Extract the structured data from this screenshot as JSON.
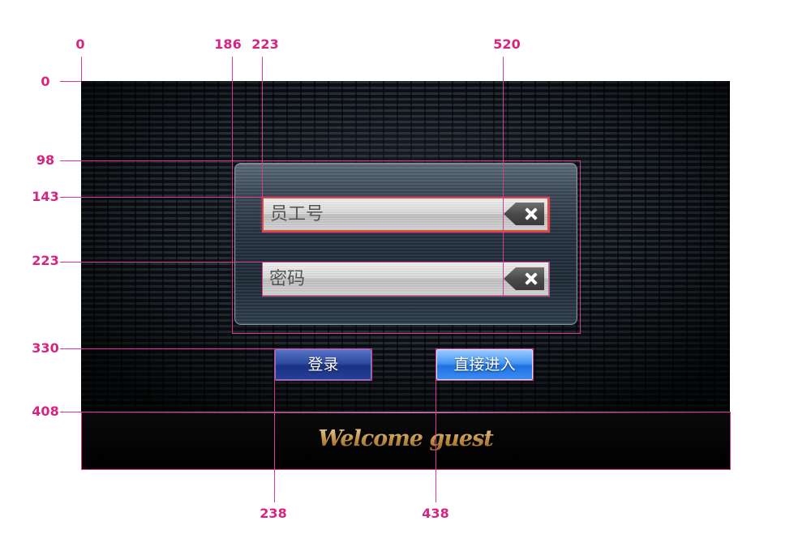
{
  "annotations": {
    "top": [
      "0",
      "186",
      "223",
      "520"
    ],
    "left": [
      "0",
      "98",
      "143",
      "223",
      "330",
      "408"
    ],
    "bottom": [
      "238",
      "438"
    ],
    "color": "#d6257f"
  },
  "login_panel": {
    "employee_field": {
      "placeholder": "员工号",
      "state": "focused",
      "clear_icon": "close-icon"
    },
    "password_field": {
      "placeholder": "密码",
      "clear_icon": "close-icon"
    }
  },
  "buttons": {
    "login_label": "登录",
    "direct_entry_label": "直接进入"
  },
  "footer": {
    "welcome_text": "Welcome guest"
  },
  "colors": {
    "focus_border": "#e0502d",
    "login_button": "#2c4aa0",
    "direct_entry_button": "#1f70e0",
    "welcome_gold": "#c49752",
    "background": "#0b0f14"
  }
}
